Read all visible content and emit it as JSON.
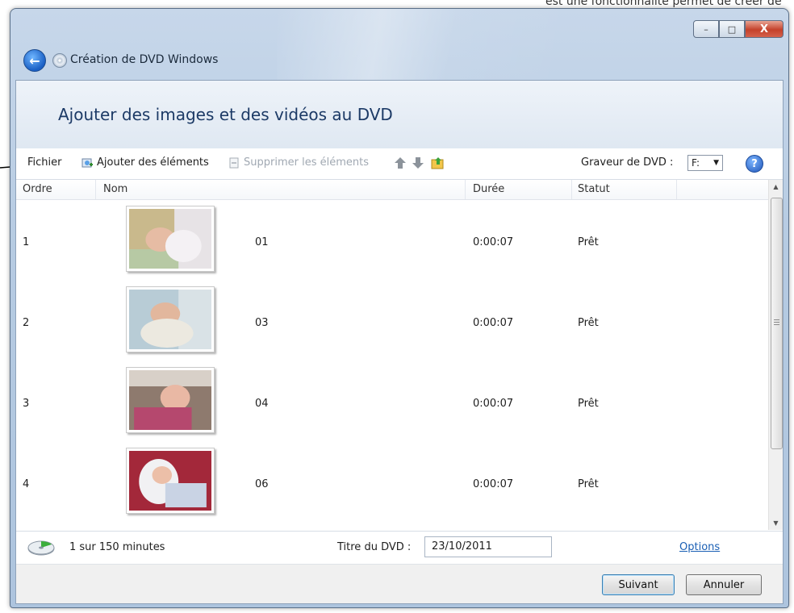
{
  "background": {
    "top_text": "est une fonctionnalité permet de créer de"
  },
  "window": {
    "title": "Création de DVD Windows",
    "caption": {
      "minimize": "–",
      "maximize": "□",
      "close": "X"
    }
  },
  "header": {
    "heading": "Ajouter des images et des vidéos au DVD"
  },
  "toolbar": {
    "file_label": "Fichier",
    "add_label": "Ajouter des éléments",
    "remove_label": "Supprimer les éléments",
    "burner_label": "Graveur de DVD :",
    "burner_value": "F:",
    "help": "?"
  },
  "table": {
    "columns": [
      "Ordre",
      "Nom",
      "Durée",
      "Statut"
    ],
    "rows": [
      {
        "order": "1",
        "name": "01",
        "duration": "0:00:07",
        "status": "Prêt"
      },
      {
        "order": "2",
        "name": "03",
        "duration": "0:00:07",
        "status": "Prêt"
      },
      {
        "order": "3",
        "name": "04",
        "duration": "0:00:07",
        "status": "Prêt"
      },
      {
        "order": "4",
        "name": "06",
        "duration": "0:00:07",
        "status": "Prêt"
      }
    ]
  },
  "footer": {
    "usage": "1 sur 150 minutes",
    "dvd_title_label": "Titre du DVD :",
    "dvd_title_value": "23/10/2011",
    "options_link": "Options",
    "next_button": "Suivant",
    "cancel_button": "Annuler"
  },
  "colors": {
    "heading": "#1c3a66",
    "link": "#1a5fb4",
    "titlebar": "#b6cbe2"
  }
}
